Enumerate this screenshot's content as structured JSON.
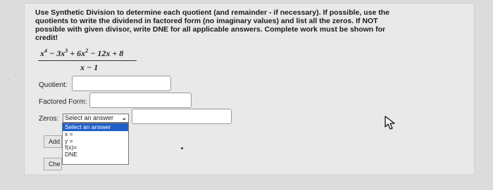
{
  "instructions": "Use Synthetic Division to determine each quotient (and remainder - if necessary). If possible, use the quotients to write the dividend in factored form (no imaginary values) and list all the zeros. If NOT possible with given divisor, write DNE for all applicable answers. Complete work must be shown for credit!",
  "problem": {
    "numerator_parts": [
      "x",
      "4",
      " − 3x",
      "3",
      " + 6x",
      "2",
      " − 12x + 8"
    ],
    "denominator": "x − 1"
  },
  "form": {
    "quotient_label": "Quotient:",
    "factored_label": "Factored Form:",
    "zeros_label": "Zeros:",
    "zeros_select_value": "Select an answer",
    "zeros_options": [
      "Select an answer",
      "x =",
      "y =",
      "f(x)=",
      "DNE"
    ],
    "add_button_label": "Add",
    "check_button_label": "Che"
  },
  "colors": {
    "selected_option_bg": "#1f5fc7",
    "input_border": "#9a9a9a"
  },
  "icons": {
    "cursor": "mouse-pointer-icon",
    "dropdown": "chevron-down-icon"
  }
}
